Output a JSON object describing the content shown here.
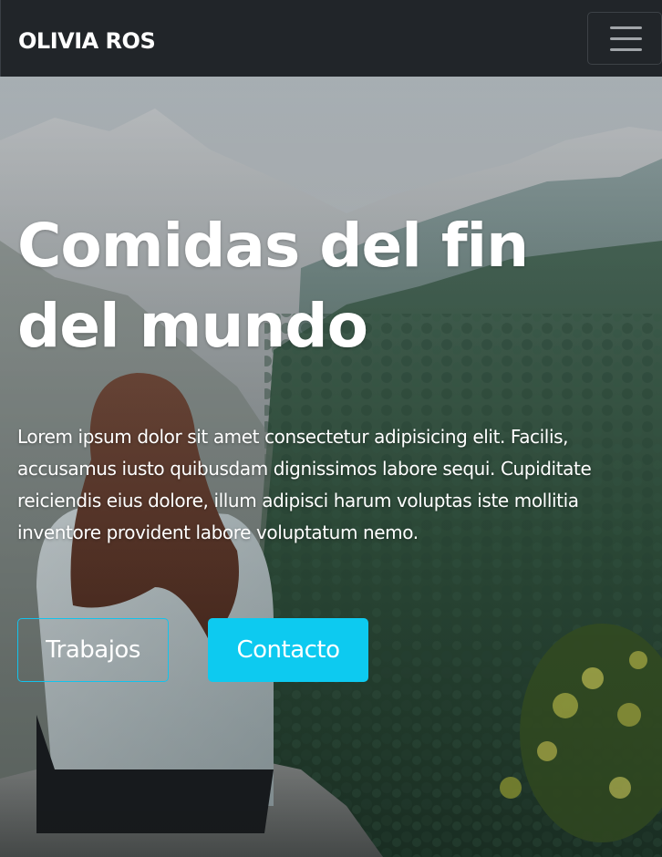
{
  "navbar": {
    "brand": "OLIVIA ROS",
    "toggler_icon": "hamburger-menu-icon"
  },
  "hero": {
    "title": "Comidas del fin del mundo",
    "text": "Lorem ipsum dolor sit amet consectetur adipisicing elit. Facilis, accusamus iusto quibusdam dignissimos labore sequi. Cupiditate reiciendis eius dolore, illum adipisci harum voluptas iste mollitia inventore provident labore voluptatum nemo.",
    "buttons": {
      "works": "Trabajos",
      "contact": "Contacto"
    }
  },
  "colors": {
    "navbar_bg": "#212529",
    "accent": "#0dcaf0",
    "text": "#ffffff"
  }
}
